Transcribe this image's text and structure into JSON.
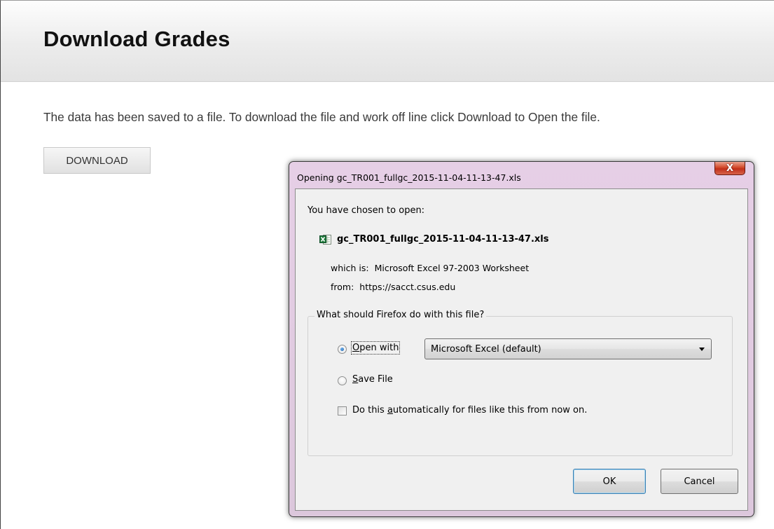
{
  "page": {
    "title": "Download Grades",
    "intro_text": "The data has been saved to a file. To download the file and work off line click Download to Open the file.",
    "download_button": "DOWNLOAD"
  },
  "dialog": {
    "title": "Opening gc_TR001_fullgc_2015-11-04-11-13-47.xls",
    "close_symbol": "X",
    "chosen_label": "You have chosen to open:",
    "file_icon": "excel-file-icon",
    "file_name": "gc_TR001_fullgc_2015-11-04-11-13-47.xls",
    "which_is_label": "which is:",
    "which_is_value": "Microsoft Excel 97-2003 Worksheet",
    "from_label": "from:",
    "from_value": "https://sacct.csus.edu",
    "group_label": "What should Firefox do with this file?",
    "open_with_prefix": "O",
    "open_with_rest": "pen with",
    "open_with_selected": true,
    "app_select_value": "Microsoft Excel (default)",
    "save_file_prefix": "S",
    "save_file_rest": "ave File",
    "save_file_selected": false,
    "auto_prefix": "Do this ",
    "auto_key": "a",
    "auto_rest": "utomatically for files like this from now on.",
    "auto_checked": false,
    "ok_label": "OK",
    "cancel_label": "Cancel"
  },
  "colors": {
    "dialog_frame": "#e6cfe6",
    "close_button": "#c0301a",
    "client_bg": "#f0f0f0",
    "header_bg": "#ececec"
  }
}
